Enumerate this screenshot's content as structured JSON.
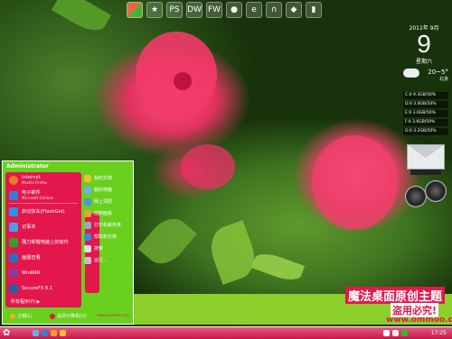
{
  "start_menu": {
    "user": "Administrator",
    "pinned": [
      {
        "title": "Internet",
        "subtitle": "Mozilla Firefox",
        "icon": "firefox-icon",
        "color": "#f07a1a"
      },
      {
        "title": "电子邮件",
        "subtitle": "Microsoft Outlook",
        "icon": "mail-icon",
        "color": "#3a7bd5"
      }
    ],
    "recent": [
      {
        "title": "启动快车(FlashGet)",
        "icon": "flashget-icon",
        "color": "#2f90e0"
      },
      {
        "title": "记事本",
        "icon": "notepad-icon",
        "color": "#4aa0e8"
      },
      {
        "title": "强力卸载电脑上的软件",
        "icon": "uninstall-icon",
        "color": "#30a030"
      },
      {
        "title": "画图查看",
        "icon": "paint-icon",
        "color": "#2d6fc0"
      },
      {
        "title": "WinRAR",
        "icon": "winrar-icon",
        "color": "#8a3c9c"
      },
      {
        "title": "SecureFX 6.1",
        "icon": "securefx-icon",
        "color": "#2a5fa8"
      }
    ],
    "all_programs": "所有程序(P)",
    "right_items": [
      {
        "label": "我的文档",
        "icon": "documents-icon",
        "color": "#f0c030"
      },
      {
        "label": "我的电脑",
        "icon": "computer-icon",
        "color": "#6cb2e8"
      },
      {
        "label": "网上邻居",
        "icon": "network-icon",
        "color": "#4a9ad8"
      },
      {
        "label": "控制面板",
        "icon": "control-panel-icon",
        "color": "#e8a040"
      },
      {
        "label": "打印机和传真",
        "icon": "printer-icon",
        "color": "#9ab"
      },
      {
        "label": "帮助和支持",
        "icon": "help-icon",
        "color": "#3a8ad0"
      },
      {
        "label": "搜索",
        "icon": "search-icon",
        "color": "#e0e0e0"
      },
      {
        "label": "运行...",
        "icon": "run-icon",
        "color": "#c0c0c0"
      }
    ],
    "logoff": "注销(L)",
    "shutdown": "关闭计算机(U)"
  },
  "top_bar": {
    "icons": [
      "windows-logo-icon",
      "star-icon",
      "photoshop-icon",
      "dreamweaver-icon",
      "fireworks-icon",
      "chat-icon",
      "ie-icon",
      "headphone-icon",
      "media-icon",
      "document-icon"
    ],
    "labels": [
      "",
      "★",
      "PS",
      "DW",
      "FW",
      "●",
      "e",
      "∩",
      "◆",
      "▮"
    ]
  },
  "calendar": {
    "year_month": "2011年 9月",
    "day": "9",
    "weekday": "星期六"
  },
  "weather": {
    "temp": "20~5°",
    "city": "北京"
  },
  "drives": [
    "C:0 9.3GB/50%",
    "D:0 3.0GB/50%",
    "E:0 3.6GB/50%",
    "F:0 3.6GB/50%",
    "G:0 3.2GB/50%"
  ],
  "banner": {
    "line1": "魔法桌面原创主题",
    "line2": "盗用必究!",
    "url": "www.ommoo.com",
    "menu_watermark": "www.ommoo.com"
  },
  "taskbar": {
    "start": "✿",
    "clock": "17:25"
  },
  "colors": {
    "accent_pink": "#e3174b",
    "accent_green": "#8ccf2a"
  }
}
